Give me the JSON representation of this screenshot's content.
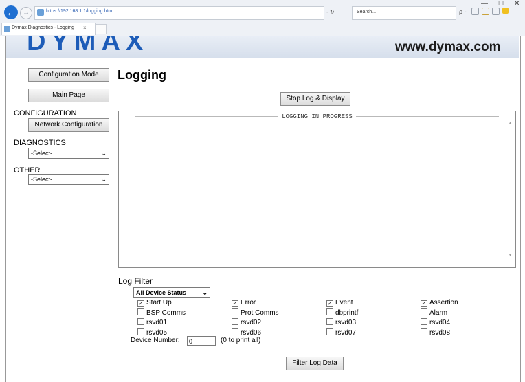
{
  "browser": {
    "url": "https://192.168.1.1/logging.htm",
    "search_placeholder": "Search...",
    "tab_title": "Dymax Diagnostics - Logging",
    "tab_close": "×",
    "nav": {
      "back": "←",
      "forward": "→"
    },
    "addr_tools": "- ↻",
    "search_icon": "ρ -",
    "window": {
      "minimize": "—",
      "maximize": "☐",
      "close": "✕"
    }
  },
  "header": {
    "site_url": "www.dymax.com",
    "logo_text": "DYMAX"
  },
  "sidebar": {
    "config_mode_label": "Configuration Mode",
    "main_page_label": "Main Page",
    "configuration_heading": "CONFIGURATION",
    "network_config_label": "Network Configuration",
    "diagnostics_heading": "DIAGNOSTICS",
    "diagnostics_select": "-Select-",
    "other_heading": "OTHER",
    "other_select": "-Select-"
  },
  "main": {
    "title": "Logging",
    "stop_button": "Stop Log & Display",
    "log_legend": "LOGGING IN PROGRESS"
  },
  "filter": {
    "title": "Log Filter",
    "status_select": "All Device Status",
    "checkboxes": [
      {
        "label": "Start Up",
        "checked": true
      },
      {
        "label": "Error",
        "checked": true
      },
      {
        "label": "Event",
        "checked": true
      },
      {
        "label": "Assertion",
        "checked": true
      },
      {
        "label": "BSP Comms",
        "checked": false
      },
      {
        "label": "Prot Comms",
        "checked": false
      },
      {
        "label": "dbprintf",
        "checked": false
      },
      {
        "label": "Alarm",
        "checked": false
      },
      {
        "label": "rsvd01",
        "checked": false
      },
      {
        "label": "rsvd02",
        "checked": false
      },
      {
        "label": "rsvd03",
        "checked": false
      },
      {
        "label": "rsvd04",
        "checked": false
      },
      {
        "label": "rsvd05",
        "checked": false
      },
      {
        "label": "rsvd06",
        "checked": false
      },
      {
        "label": "rsvd07",
        "checked": false
      },
      {
        "label": "rsvd08",
        "checked": false
      }
    ],
    "device_number_label": "Device Number:",
    "device_number_value": "0",
    "device_number_hint": "(0 to print all)",
    "filter_button": "Filter Log Data"
  }
}
